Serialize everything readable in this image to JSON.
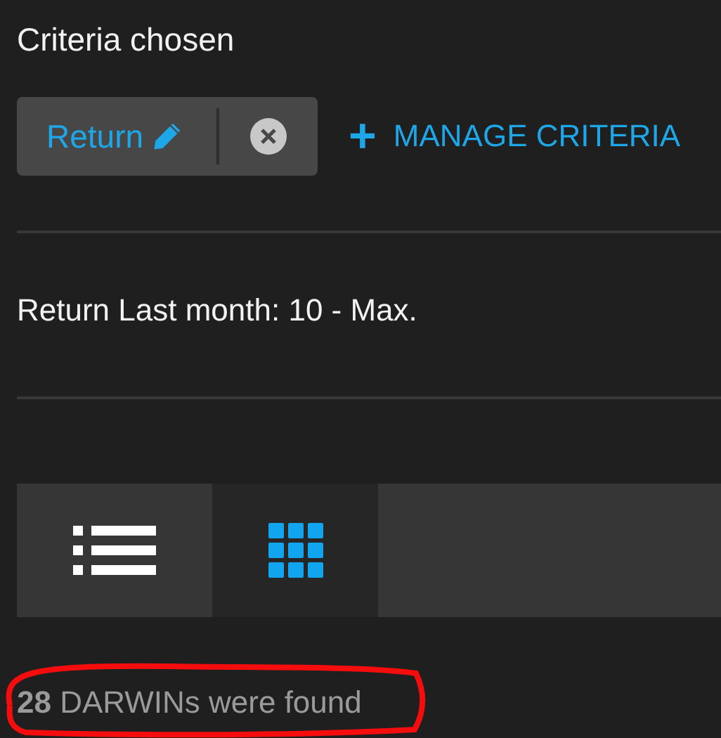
{
  "heading": "Criteria chosen",
  "criteria": [
    {
      "label": "Return"
    }
  ],
  "manage_button": {
    "icon": "+",
    "label": "MANAGE CRITERIA"
  },
  "criteria_summary": "Return Last month: 10 - Max.",
  "view_toggle": [
    {
      "kind": "list",
      "selected": false
    },
    {
      "kind": "grid",
      "selected": true
    }
  ],
  "result_count": "**28** DARWINs were found"
}
